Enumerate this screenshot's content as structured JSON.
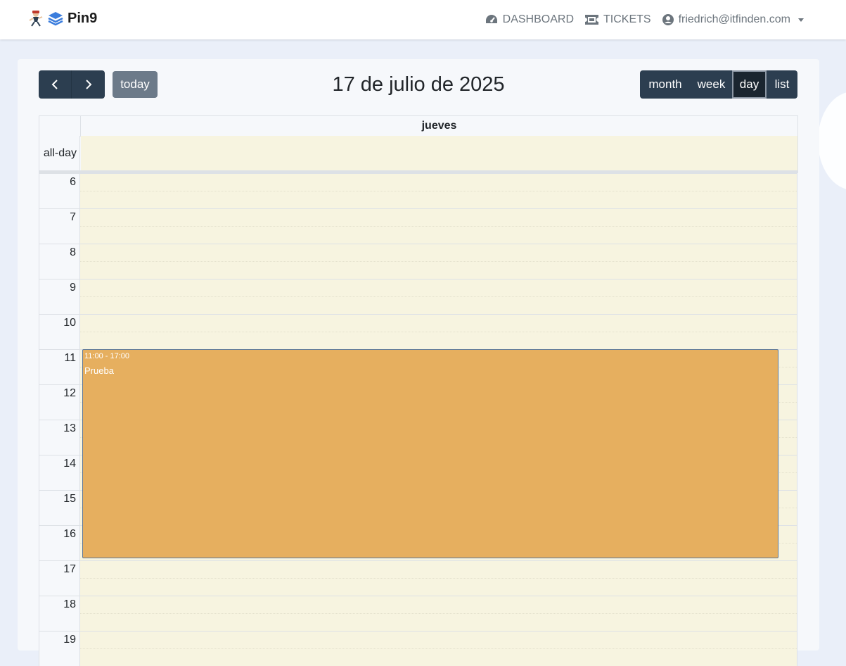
{
  "nav": {
    "brand": "Pin9",
    "links": {
      "dashboard": "DASHBOARD",
      "tickets": "TICKETS"
    },
    "user": "friedrich@itfinden.com"
  },
  "toolbar": {
    "prev_icon": "chevron-left-icon",
    "next_icon": "chevron-right-icon",
    "today": "today",
    "title": "17 de julio de 2025",
    "views": {
      "month": "month",
      "week": "week",
      "day": "day",
      "list": "list"
    },
    "active_view": "day"
  },
  "calendar": {
    "day_header": "jueves",
    "allday_label": "all-day",
    "hours": [
      "6",
      "7",
      "8",
      "9",
      "10",
      "11",
      "12",
      "13",
      "14",
      "15",
      "16",
      "17",
      "18",
      "19"
    ],
    "event": {
      "time": "11:00 - 17:00",
      "title": "Prueba",
      "color": "#e6af5f"
    }
  },
  "colors": {
    "accent": "#2c3e50",
    "slot_background": "#f7f4e0"
  }
}
